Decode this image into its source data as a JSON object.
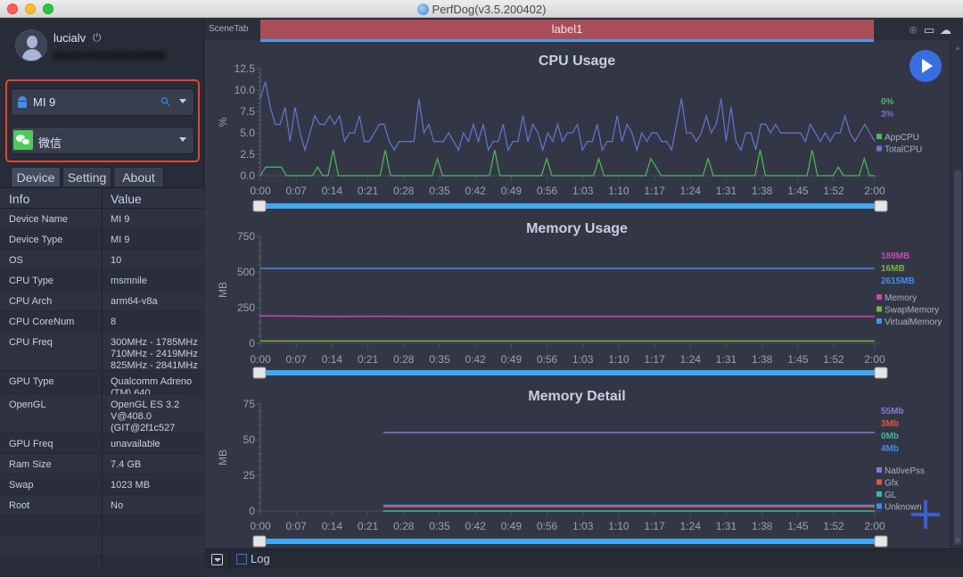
{
  "window": {
    "title": "PerfDog(v3.5.200402)"
  },
  "user": {
    "name": "lucialv",
    "email": "lucian@tencent.com"
  },
  "device_selector": {
    "value": "MI 9"
  },
  "app_selector": {
    "value": "微信"
  },
  "tabs": [
    {
      "label": "Device",
      "active": true
    },
    {
      "label": "Setting",
      "active": false
    },
    {
      "label": "About",
      "active": false
    }
  ],
  "info_table": {
    "headers": [
      "Info",
      "Value"
    ],
    "rows": [
      {
        "key": "Device Name",
        "value": "MI 9"
      },
      {
        "key": "Device Type",
        "value": "MI 9"
      },
      {
        "key": "OS",
        "value": "10"
      },
      {
        "key": "CPU Type",
        "value": "msmnile"
      },
      {
        "key": "CPU Arch",
        "value": "arm64-v8a"
      },
      {
        "key": "CPU CoreNum",
        "value": "8"
      },
      {
        "key": "CPU Freq",
        "value": "300MHz - 1785MHz\n710MHz - 2419MHz\n825MHz - 2841MHz"
      },
      {
        "key": "GPU Type",
        "value": "Qualcomm Adreno\n(TM) 640"
      },
      {
        "key": "OpenGL",
        "value": "OpenGL ES 3.2\nV@408.0\n(GIT@2f1c527"
      },
      {
        "key": "GPU Freq",
        "value": "unavailable"
      },
      {
        "key": "Ram Size",
        "value": "7.4 GB"
      },
      {
        "key": "Swap",
        "value": "1023 MB"
      },
      {
        "key": "Root",
        "value": "No"
      }
    ]
  },
  "scene": {
    "tab_label": "SceneTab",
    "label": "label1"
  },
  "toolbar_icons": [
    "location-pin-icon",
    "folder-icon",
    "cloud-icon"
  ],
  "bottom_bar": {
    "log_label": "Log",
    "log_checked": false
  },
  "colors": {
    "accent": "#3a6ee0",
    "scene_label": "#a94d5a",
    "range_bar": "#3fa9f5",
    "highlight_box": "#e6452b"
  },
  "chart_data": [
    {
      "type": "line",
      "title": "CPU Usage",
      "ylabel": "%",
      "xlabel": "",
      "ylim": [
        0,
        12.5
      ],
      "yticks": [
        "0.0",
        "2.5",
        "5.0",
        "7.5",
        "10.0",
        "12.5"
      ],
      "xlim_seconds": [
        0,
        120
      ],
      "xticks": [
        "0:00",
        "0:07",
        "0:14",
        "0:21",
        "0:28",
        "0:35",
        "0:42",
        "0:49",
        "0:56",
        "1:03",
        "1:10",
        "1:17",
        "1:24",
        "1:31",
        "1:38",
        "1:45",
        "1:52",
        "2:00"
      ],
      "legend": "right",
      "series": [
        {
          "name": "AppCPU",
          "color": "#4cbb5a",
          "current": "0%",
          "start": 0,
          "values": [
            0,
            1,
            1,
            1,
            1,
            0,
            0,
            0,
            0,
            0,
            0,
            1,
            0,
            0,
            3,
            0,
            0,
            0,
            0,
            0,
            0,
            0,
            0,
            0,
            3,
            0,
            0,
            0,
            0,
            0,
            0,
            0,
            0,
            0,
            2,
            0,
            0,
            0,
            0,
            0,
            0,
            0,
            0,
            0,
            0,
            3,
            0,
            0,
            0,
            0,
            0,
            0,
            0,
            0,
            0,
            2,
            0,
            0,
            0,
            0,
            0,
            0,
            0,
            0,
            0,
            2,
            0,
            0,
            0,
            0,
            0,
            0,
            0,
            0,
            0,
            2,
            1,
            0,
            0,
            0,
            0,
            0,
            0,
            0,
            0,
            0,
            2,
            0,
            0,
            0,
            0,
            0,
            0,
            0,
            0,
            0,
            3,
            0,
            0,
            0,
            0,
            0,
            0,
            0,
            0,
            0,
            3,
            0,
            0,
            0,
            0,
            1,
            0,
            0,
            0,
            0,
            2,
            0,
            0
          ]
        },
        {
          "name": "TotalCPU",
          "color": "#6674d4",
          "current": "3%",
          "start": 0,
          "values": [
            9,
            11,
            8,
            6,
            6,
            8,
            4,
            8,
            5,
            3,
            5,
            7,
            6,
            6,
            7,
            6,
            7,
            4,
            5,
            5,
            7,
            4,
            4,
            5,
            6,
            6,
            4,
            3,
            4,
            4,
            4,
            4,
            9,
            5,
            6,
            4,
            4,
            4,
            5,
            4,
            3,
            5,
            4,
            6,
            4,
            6,
            3,
            4,
            4,
            6,
            3,
            4,
            4,
            7,
            4,
            6,
            5,
            3,
            5,
            4,
            6,
            4,
            5,
            5,
            6,
            3,
            4,
            4,
            6,
            3,
            4,
            4,
            7,
            4,
            6,
            5,
            3,
            5,
            4,
            5,
            5,
            4,
            4,
            3,
            6,
            9,
            5,
            5,
            4,
            5,
            7,
            5,
            6,
            9,
            4,
            8,
            4,
            3,
            5,
            5,
            3,
            6,
            6,
            5,
            6,
            5,
            5,
            5,
            5,
            5,
            4,
            6,
            5,
            4,
            5,
            4,
            5,
            5,
            7,
            5,
            4,
            5,
            6,
            5,
            4
          ]
        }
      ]
    },
    {
      "type": "line",
      "title": "Memory Usage",
      "ylabel": "MB",
      "xlabel": "",
      "ylim": [
        0,
        750
      ],
      "yticks": [
        "0",
        "250",
        "500",
        "750"
      ],
      "xlim_seconds": [
        0,
        120
      ],
      "xticks": [
        "0:00",
        "0:07",
        "0:14",
        "0:21",
        "0:28",
        "0:35",
        "0:42",
        "0:49",
        "0:56",
        "1:03",
        "1:10",
        "1:17",
        "1:24",
        "1:31",
        "1:38",
        "1:45",
        "1:52",
        "2:00"
      ],
      "legend": "right",
      "series": [
        {
          "name": "Memory",
          "color": "#c54bb3",
          "current": "189MB",
          "start": 0,
          "values": [
            193,
            191,
            190,
            189,
            190,
            190,
            189,
            189,
            189,
            189,
            189,
            189,
            189,
            189,
            189,
            189,
            189,
            189,
            189,
            189,
            189,
            189,
            189,
            189,
            189
          ]
        },
        {
          "name": "SwapMemory",
          "color": "#78b53c",
          "current": "16MB",
          "start": 0,
          "values": [
            16,
            16,
            16,
            16,
            16,
            16,
            16,
            16,
            16,
            16,
            16,
            16,
            16,
            16,
            16,
            16,
            16,
            16,
            16,
            16,
            16,
            16,
            16,
            16,
            16
          ]
        },
        {
          "name": "VirtualMemory",
          "color": "#3f8ef0",
          "current": "2615MB",
          "start": 0,
          "values": [
            525,
            525,
            525,
            525,
            525,
            525,
            525,
            525,
            525,
            525,
            525,
            525,
            525,
            525,
            525,
            525,
            525,
            525,
            525,
            525,
            525,
            525,
            525,
            525,
            525
          ]
        }
      ]
    },
    {
      "type": "line",
      "title": "Memory Detail",
      "ylabel": "MB",
      "xlabel": "",
      "ylim": [
        0,
        75
      ],
      "yticks": [
        "0",
        "25",
        "50",
        "75"
      ],
      "xlim_seconds": [
        0,
        120
      ],
      "xticks": [
        "0:00",
        "0:07",
        "0:14",
        "0:21",
        "0:28",
        "0:35",
        "0:42",
        "0:49",
        "0:56",
        "1:03",
        "1:10",
        "1:17",
        "1:24",
        "1:31",
        "1:38",
        "1:45",
        "1:52",
        "2:00"
      ],
      "legend": "right",
      "series": [
        {
          "name": "NativePss",
          "color": "#8a73dc",
          "current": "55Mb",
          "start": 24,
          "values": [
            55,
            55,
            55,
            55,
            55,
            55,
            55,
            55,
            55,
            55,
            55,
            55,
            55,
            55,
            55,
            55,
            55,
            55,
            55,
            55
          ]
        },
        {
          "name": "Gfx",
          "color": "#e0573e",
          "current": "3Mb",
          "start": 24,
          "values": [
            3,
            3,
            3,
            3,
            3,
            3,
            3,
            3,
            3,
            3,
            3,
            3,
            3,
            3,
            3,
            3,
            3,
            3,
            3,
            3
          ]
        },
        {
          "name": "GL",
          "color": "#3fb59c",
          "current": "0Mb",
          "start": 24,
          "values": [
            0,
            0,
            0,
            0,
            0,
            0,
            0,
            0,
            0,
            0,
            0,
            0,
            0,
            0,
            0,
            0,
            0,
            0,
            0,
            0
          ]
        },
        {
          "name": "Unknown",
          "color": "#3f8ef0",
          "current": "4Mb",
          "start": 24,
          "values": [
            4,
            4,
            4,
            4,
            4,
            4,
            4,
            4,
            4,
            4,
            4,
            4,
            4,
            4,
            4,
            4,
            4,
            4,
            4,
            4
          ]
        }
      ]
    }
  ]
}
